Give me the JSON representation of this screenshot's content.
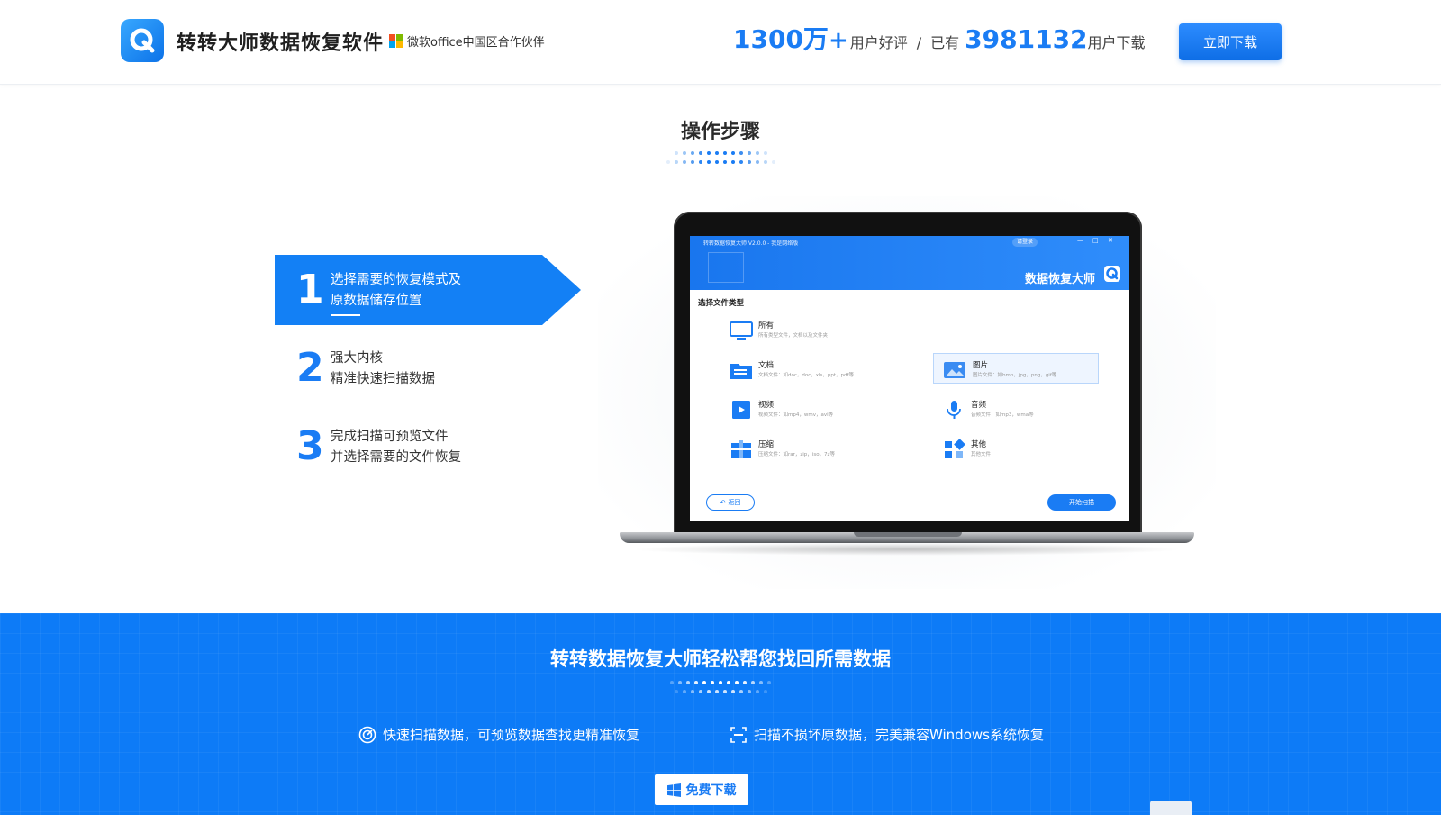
{
  "header": {
    "brand_title": "转转大师数据恢复软件",
    "partner_text": "微软office中国区合作伙伴",
    "stat1_number": "1300万",
    "stat1_plus": "+",
    "stat1_label": "用户好评",
    "separator": "/",
    "stat2_prefix": "已有",
    "stat2_number": "3981132",
    "stat2_label": "用户下载",
    "download_button": "立即下载"
  },
  "steps_section": {
    "title": "操作步骤",
    "steps": [
      {
        "number": "1",
        "line1": "选择需要的恢复模式及",
        "line2": "原数据储存位置",
        "active": true
      },
      {
        "number": "2",
        "line1": "强大内核",
        "line2": "精准快速扫描数据",
        "active": false
      },
      {
        "number": "3",
        "line1": "完成扫描可预览文件",
        "line2": "并选择需要的文件恢复",
        "active": false
      }
    ]
  },
  "app_preview": {
    "window_title": "转转数据恢复大师 V2.0.0 - 我是网络版",
    "login": "请登录",
    "brand": "数据恢复大师",
    "section_label": "选择文件类型",
    "file_types": [
      {
        "name": "所有",
        "desc": "所有类型文件，文档以及文件夹"
      },
      {
        "name": "文档",
        "desc": "文档文件：如doc，doc，xls，ppt，pdf等"
      },
      {
        "name": "图片",
        "desc": "图片文件：如bmp，jpg，png，gif等"
      },
      {
        "name": "视频",
        "desc": "视频文件：如mp4，wmv，avi等"
      },
      {
        "name": "音频",
        "desc": "音频文件：如mp3，wma等"
      },
      {
        "name": "压缩",
        "desc": "压缩文件：如rar，zip，iso，7z等"
      },
      {
        "name": "其他",
        "desc": "其他文件"
      }
    ],
    "back_button": "返回",
    "scan_button": "开始扫描"
  },
  "band": {
    "title": "转转数据恢复大师轻松帮您找回所需数据",
    "feature1": "快速扫描数据，可预览数据查找更精准恢复",
    "feature2": "扫描不损坏原数据，完美兼容Windows系统恢复",
    "free_download": "免费下载"
  },
  "colors": {
    "accent": "#1a7cf4",
    "band": "#0d7bf7",
    "step_active_bg": "#1380f5"
  }
}
